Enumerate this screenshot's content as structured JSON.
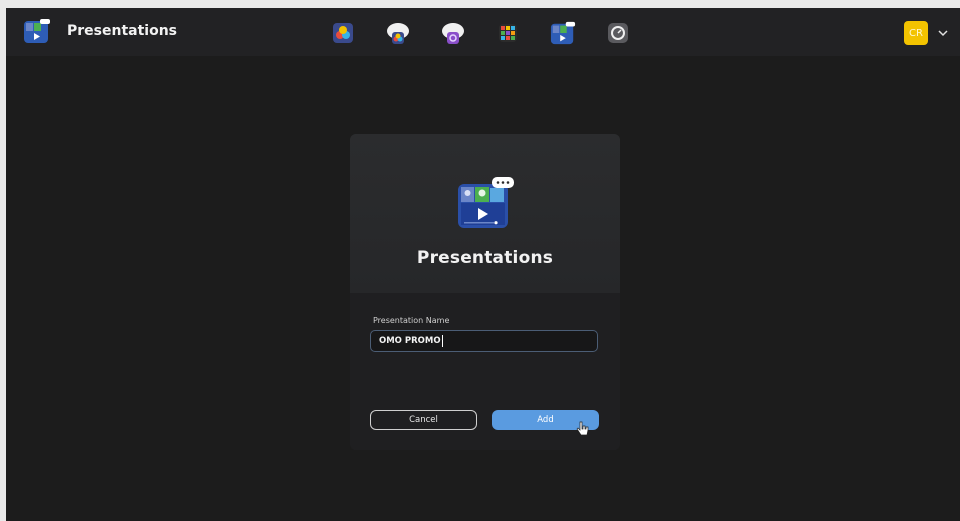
{
  "app": {
    "title": "Presentations",
    "icon": "presentations-icon"
  },
  "launchers": [
    {
      "name": "davinci-resolve-icon"
    },
    {
      "name": "cloud-resolve-icon"
    },
    {
      "name": "cloud-storage-icon"
    },
    {
      "name": "media-grid-icon"
    },
    {
      "name": "presentations-icon"
    },
    {
      "name": "settings-icon"
    }
  ],
  "user": {
    "initials": "CR",
    "avatar_color": "#f3c300"
  },
  "dialog": {
    "title": "Presentations",
    "field_label": "Presentation Name",
    "field_value": "OMO PROMO",
    "cancel_label": "Cancel",
    "add_label": "Add",
    "accent": "#5a9be0"
  }
}
